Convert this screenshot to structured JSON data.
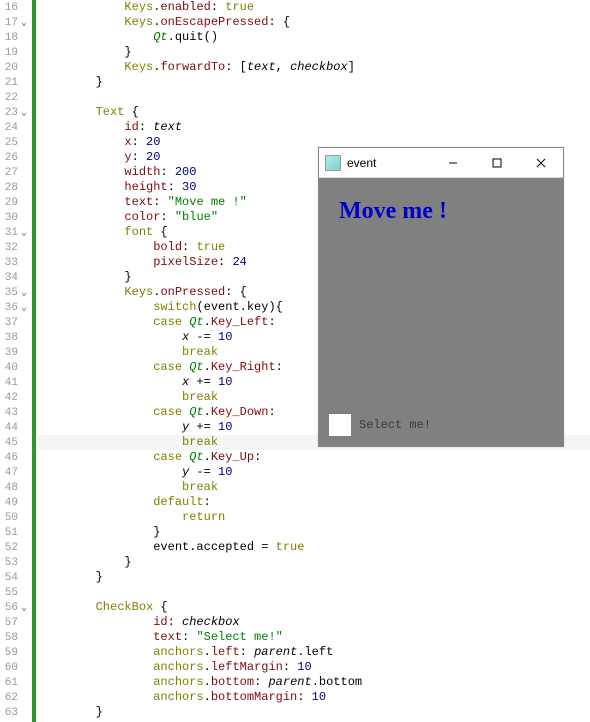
{
  "gutter": {
    "start": 16,
    "end": 63,
    "folds": [
      17,
      23,
      31,
      35,
      36,
      56
    ]
  },
  "current_line": 45,
  "code": [
    {
      "i": "            ",
      "t": [
        [
          "t-type",
          "Keys"
        ],
        [
          "t-op",
          "."
        ],
        [
          "t-prop",
          "enabled"
        ],
        [
          "t-op",
          ": "
        ],
        [
          "t-kw",
          "true"
        ]
      ]
    },
    {
      "i": "            ",
      "t": [
        [
          "t-type",
          "Keys"
        ],
        [
          "t-op",
          "."
        ],
        [
          "t-prop",
          "onEscapePressed"
        ],
        [
          "t-op",
          ": {"
        ]
      ]
    },
    {
      "i": "                ",
      "t": [
        [
          "t-qt",
          "Qt"
        ],
        [
          "t-op",
          ".quit()"
        ]
      ]
    },
    {
      "i": "            ",
      "t": [
        [
          "t-op",
          "}"
        ]
      ]
    },
    {
      "i": "            ",
      "t": [
        [
          "t-type",
          "Keys"
        ],
        [
          "t-op",
          "."
        ],
        [
          "t-prop",
          "forwardTo"
        ],
        [
          "t-op",
          ": ["
        ],
        [
          "t-id",
          "text"
        ],
        [
          "t-op",
          ", "
        ],
        [
          "t-id",
          "checkbox"
        ],
        [
          "t-op",
          "]"
        ]
      ]
    },
    {
      "i": "        ",
      "t": [
        [
          "t-op",
          "}"
        ]
      ]
    },
    {
      "i": "",
      "t": []
    },
    {
      "i": "        ",
      "t": [
        [
          "t-type",
          "Text"
        ],
        [
          "t-op",
          " {"
        ]
      ]
    },
    {
      "i": "            ",
      "t": [
        [
          "t-prop",
          "id"
        ],
        [
          "t-op",
          ": "
        ],
        [
          "t-id",
          "text"
        ]
      ]
    },
    {
      "i": "            ",
      "t": [
        [
          "t-prop",
          "x"
        ],
        [
          "t-op",
          ": "
        ],
        [
          "t-num",
          "20"
        ]
      ]
    },
    {
      "i": "            ",
      "t": [
        [
          "t-prop",
          "y"
        ],
        [
          "t-op",
          ": "
        ],
        [
          "t-num",
          "20"
        ]
      ]
    },
    {
      "i": "            ",
      "t": [
        [
          "t-prop",
          "width"
        ],
        [
          "t-op",
          ": "
        ],
        [
          "t-num",
          "200"
        ]
      ]
    },
    {
      "i": "            ",
      "t": [
        [
          "t-prop",
          "height"
        ],
        [
          "t-op",
          ": "
        ],
        [
          "t-num",
          "30"
        ]
      ]
    },
    {
      "i": "            ",
      "t": [
        [
          "t-prop",
          "text"
        ],
        [
          "t-op",
          ": "
        ],
        [
          "t-str",
          "\"Move me !\""
        ]
      ]
    },
    {
      "i": "            ",
      "t": [
        [
          "t-prop",
          "color"
        ],
        [
          "t-op",
          ": "
        ],
        [
          "t-str",
          "\"blue\""
        ]
      ]
    },
    {
      "i": "            ",
      "t": [
        [
          "t-type",
          "font"
        ],
        [
          "t-op",
          " {"
        ]
      ]
    },
    {
      "i": "                ",
      "t": [
        [
          "t-prop",
          "bold"
        ],
        [
          "t-op",
          ": "
        ],
        [
          "t-kw",
          "true"
        ]
      ]
    },
    {
      "i": "                ",
      "t": [
        [
          "t-prop",
          "pixelSize"
        ],
        [
          "t-op",
          ": "
        ],
        [
          "t-num",
          "24"
        ]
      ]
    },
    {
      "i": "            ",
      "t": [
        [
          "t-op",
          "}"
        ]
      ]
    },
    {
      "i": "            ",
      "t": [
        [
          "t-type",
          "Keys"
        ],
        [
          "t-op",
          "."
        ],
        [
          "t-prop",
          "onPressed"
        ],
        [
          "t-op",
          ": {"
        ]
      ]
    },
    {
      "i": "                ",
      "t": [
        [
          "t-kw",
          "switch"
        ],
        [
          "t-op",
          "(event.key){"
        ]
      ]
    },
    {
      "i": "                ",
      "t": [
        [
          "t-kw",
          "case"
        ],
        [
          "t-op",
          " "
        ],
        [
          "t-qt",
          "Qt"
        ],
        [
          "t-op",
          "."
        ],
        [
          "t-const",
          "Key_Left"
        ],
        [
          "t-op",
          ":"
        ]
      ]
    },
    {
      "i": "                    ",
      "t": [
        [
          "t-id",
          "x"
        ],
        [
          "t-op",
          " -= "
        ],
        [
          "t-num",
          "10"
        ]
      ]
    },
    {
      "i": "                    ",
      "t": [
        [
          "t-kw",
          "break"
        ]
      ]
    },
    {
      "i": "                ",
      "t": [
        [
          "t-kw",
          "case"
        ],
        [
          "t-op",
          " "
        ],
        [
          "t-qt",
          "Qt"
        ],
        [
          "t-op",
          "."
        ],
        [
          "t-const",
          "Key_Right"
        ],
        [
          "t-op",
          ":"
        ]
      ]
    },
    {
      "i": "                    ",
      "t": [
        [
          "t-id",
          "x"
        ],
        [
          "t-op",
          " += "
        ],
        [
          "t-num",
          "10"
        ]
      ]
    },
    {
      "i": "                    ",
      "t": [
        [
          "t-kw",
          "break"
        ]
      ]
    },
    {
      "i": "                ",
      "t": [
        [
          "t-kw",
          "case"
        ],
        [
          "t-op",
          " "
        ],
        [
          "t-qt",
          "Qt"
        ],
        [
          "t-op",
          "."
        ],
        [
          "t-const",
          "Key_Down"
        ],
        [
          "t-op",
          ":"
        ]
      ]
    },
    {
      "i": "                    ",
      "t": [
        [
          "t-id",
          "y"
        ],
        [
          "t-op",
          " += "
        ],
        [
          "t-num",
          "10"
        ]
      ]
    },
    {
      "i": "                    ",
      "t": [
        [
          "t-kw",
          "break"
        ]
      ]
    },
    {
      "i": "                ",
      "t": [
        [
          "t-kw",
          "case"
        ],
        [
          "t-op",
          " "
        ],
        [
          "t-qt",
          "Qt"
        ],
        [
          "t-op",
          "."
        ],
        [
          "t-const",
          "Key_Up"
        ],
        [
          "t-op",
          ":"
        ]
      ]
    },
    {
      "i": "                    ",
      "t": [
        [
          "t-id",
          "y"
        ],
        [
          "t-op",
          " -= "
        ],
        [
          "t-num",
          "10"
        ]
      ]
    },
    {
      "i": "                    ",
      "t": [
        [
          "t-kw",
          "break"
        ]
      ]
    },
    {
      "i": "                ",
      "t": [
        [
          "t-kw",
          "default"
        ],
        [
          "t-op",
          ":"
        ]
      ]
    },
    {
      "i": "                    ",
      "t": [
        [
          "t-kw",
          "return"
        ]
      ]
    },
    {
      "i": "                ",
      "t": [
        [
          "t-op",
          "}"
        ]
      ]
    },
    {
      "i": "                ",
      "t": [
        [
          "t-op",
          "event.accepted = "
        ],
        [
          "t-kw",
          "true"
        ]
      ]
    },
    {
      "i": "            ",
      "t": [
        [
          "t-op",
          "}"
        ]
      ]
    },
    {
      "i": "        ",
      "t": [
        [
          "t-op",
          "}"
        ]
      ]
    },
    {
      "i": "",
      "t": []
    },
    {
      "i": "        ",
      "t": [
        [
          "t-type",
          "CheckBox"
        ],
        [
          "t-op",
          " {"
        ]
      ]
    },
    {
      "i": "                ",
      "t": [
        [
          "t-prop",
          "id"
        ],
        [
          "t-op",
          ": "
        ],
        [
          "t-id",
          "checkbox"
        ]
      ]
    },
    {
      "i": "                ",
      "t": [
        [
          "t-prop",
          "text"
        ],
        [
          "t-op",
          ": "
        ],
        [
          "t-str",
          "\"Select me!\""
        ]
      ]
    },
    {
      "i": "                ",
      "t": [
        [
          "t-type",
          "anchors"
        ],
        [
          "t-op",
          "."
        ],
        [
          "t-prop",
          "left"
        ],
        [
          "t-op",
          ": "
        ],
        [
          "t-id",
          "parent"
        ],
        [
          "t-op",
          ".left"
        ]
      ]
    },
    {
      "i": "                ",
      "t": [
        [
          "t-type",
          "anchors"
        ],
        [
          "t-op",
          "."
        ],
        [
          "t-prop",
          "leftMargin"
        ],
        [
          "t-op",
          ": "
        ],
        [
          "t-num",
          "10"
        ]
      ]
    },
    {
      "i": "                ",
      "t": [
        [
          "t-type",
          "anchors"
        ],
        [
          "t-op",
          "."
        ],
        [
          "t-prop",
          "bottom"
        ],
        [
          "t-op",
          ": "
        ],
        [
          "t-id",
          "parent"
        ],
        [
          "t-op",
          ".bottom"
        ]
      ]
    },
    {
      "i": "                ",
      "t": [
        [
          "t-type",
          "anchors"
        ],
        [
          "t-op",
          "."
        ],
        [
          "t-prop",
          "bottomMargin"
        ],
        [
          "t-op",
          ": "
        ],
        [
          "t-num",
          "10"
        ]
      ]
    },
    {
      "i": "        ",
      "t": [
        [
          "t-op",
          "}"
        ]
      ]
    }
  ],
  "app": {
    "title": "event",
    "move_text": "Move me !",
    "checkbox_label": "Select me!"
  }
}
